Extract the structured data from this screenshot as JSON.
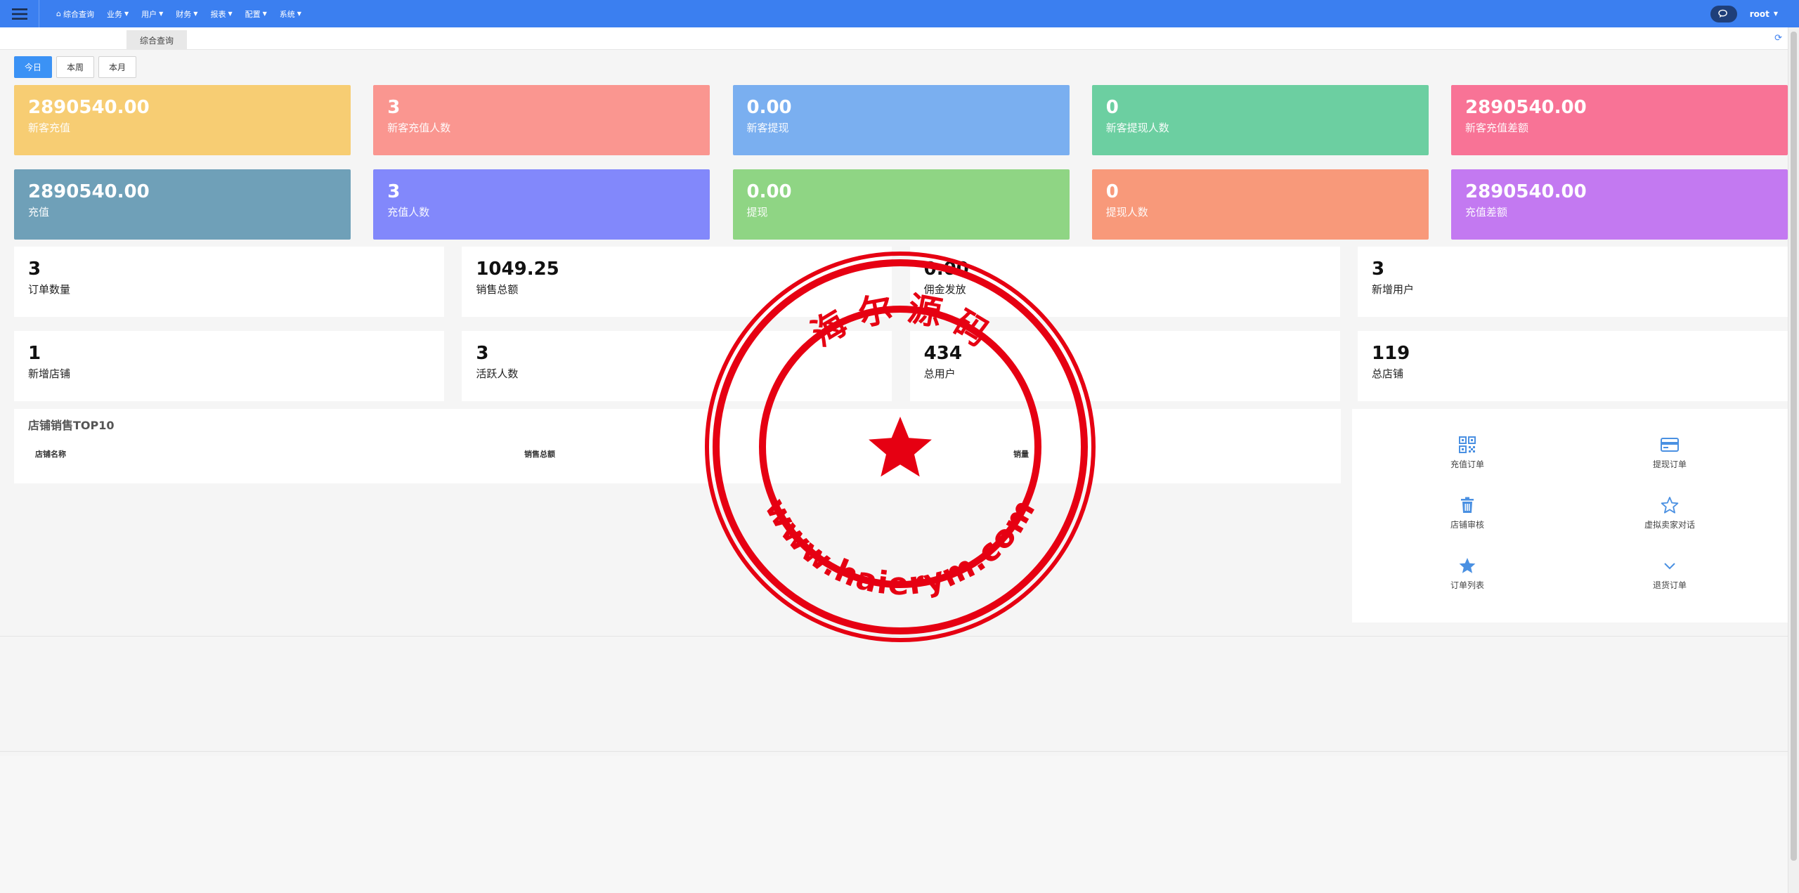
{
  "navbar": {
    "menu": [
      {
        "label": "综合查询",
        "has_home_icon": true
      },
      {
        "label": "业务",
        "dropdown": true
      },
      {
        "label": "用户",
        "dropdown": true
      },
      {
        "label": "财务",
        "dropdown": true
      },
      {
        "label": "报表",
        "dropdown": true
      },
      {
        "label": "配置",
        "dropdown": true
      },
      {
        "label": "系统",
        "dropdown": true
      }
    ],
    "user": "root"
  },
  "tabs": {
    "active": "综合查询"
  },
  "periods": [
    "今日",
    "本周",
    "本月"
  ],
  "stat_row1": [
    {
      "value": "2890540.00",
      "label": "新客充值",
      "color": "#f7cd73"
    },
    {
      "value": "3",
      "label": "新客充值人数",
      "color": "#fa9690"
    },
    {
      "value": "0.00",
      "label": "新客提现",
      "color": "#7aaff0"
    },
    {
      "value": "0",
      "label": "新客提现人数",
      "color": "#6ccfa1"
    },
    {
      "value": "2890540.00",
      "label": "新客充值差额",
      "color": "#f87396"
    }
  ],
  "stat_row2": [
    {
      "value": "2890540.00",
      "label": "充值",
      "color": "#6fa0b8"
    },
    {
      "value": "3",
      "label": "充值人数",
      "color": "#8288fb"
    },
    {
      "value": "0.00",
      "label": "提现",
      "color": "#8fd584"
    },
    {
      "value": "0",
      "label": "提现人数",
      "color": "#f8997a"
    },
    {
      "value": "2890540.00",
      "label": "充值差额",
      "color": "#c379f1"
    }
  ],
  "stat_row3": [
    {
      "value": "3",
      "label": "订单数量"
    },
    {
      "value": "1049.25",
      "label": "销售总额"
    },
    {
      "value": "0.00",
      "label": "佣金发放"
    },
    {
      "value": "3",
      "label": "新增用户"
    }
  ],
  "stat_row4": [
    {
      "value": "1",
      "label": "新增店铺"
    },
    {
      "value": "3",
      "label": "活跃人数"
    },
    {
      "value": "434",
      "label": "总用户"
    },
    {
      "value": "119",
      "label": "总店铺"
    }
  ],
  "top10": {
    "title": "店铺销售TOP10",
    "columns": [
      "店铺名称",
      "销售总额",
      "销量"
    ]
  },
  "quick_links": [
    {
      "label": "充值订单",
      "icon": "qrcode-icon"
    },
    {
      "label": "提现订单",
      "icon": "credit-card-icon"
    },
    {
      "label": "店铺审核",
      "icon": "trash-icon"
    },
    {
      "label": "虚拟卖家对话",
      "icon": "star-outline-icon"
    },
    {
      "label": "订单列表",
      "icon": "star-filled-icon"
    },
    {
      "label": "退货订单",
      "icon": "chevron-down-icon"
    }
  ],
  "watermark": {
    "top_text": "海 尔 源 码",
    "bottom_text": "www.haierym.com",
    "color": "#e60012"
  }
}
